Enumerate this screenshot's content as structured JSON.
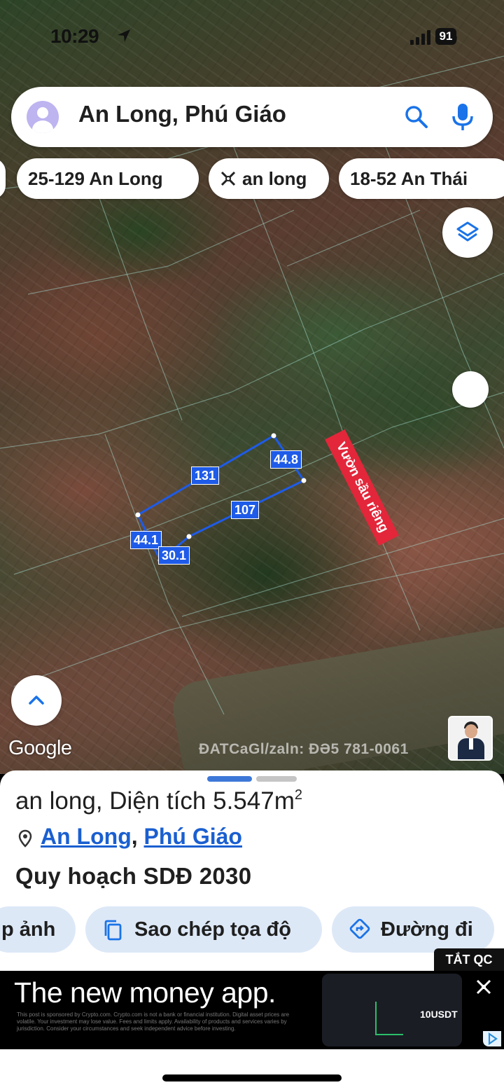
{
  "status_bar": {
    "time": "10:29",
    "network": "5G",
    "battery": "91"
  },
  "search": {
    "query": "An Long, Phú Giáo"
  },
  "chips": [
    {
      "label": "25-129 An Long"
    },
    {
      "label": "an long"
    },
    {
      "label": "18-52 An Thái"
    }
  ],
  "map": {
    "measurements": {
      "top": "131",
      "right": "44.8",
      "middle": "107",
      "left": "44.1",
      "bottom": "30.1"
    },
    "tag": "Vườn sầu riêng",
    "brand": "Google",
    "watermark": "ĐATCaGl/zaln: ĐƏ5 781-0061",
    "parcel_color": "#1e5be8",
    "tag_color": "#e3263a"
  },
  "place": {
    "title": "an long, Diện tích 5.547m",
    "title_sup": "2",
    "locality": "An Long",
    "separator": ",",
    "district": "Phú Giáo",
    "plan": "Quy hoạch SDĐ 2030"
  },
  "actions": [
    {
      "label": "p ảnh"
    },
    {
      "label": "Sao chép tọa độ"
    },
    {
      "label": "Đường đi"
    }
  ],
  "ad": {
    "dismiss_label": "TẮT QC",
    "headline": "The new money app.",
    "fine_print": "This post is sponsored by Crypto.com. Crypto.com is not a bank or financial institution. Digital asset prices are volatile. Your investment may lose value. Fees and limits apply. Availability of products and services varies by jurisdiction. Consider your circumstances and seek independent advice before investing.",
    "phone_figure": "10USDT"
  },
  "colors": {
    "link": "#1a5fd0",
    "accent": "#3d78d8",
    "action_bg": "#dde8f7"
  }
}
